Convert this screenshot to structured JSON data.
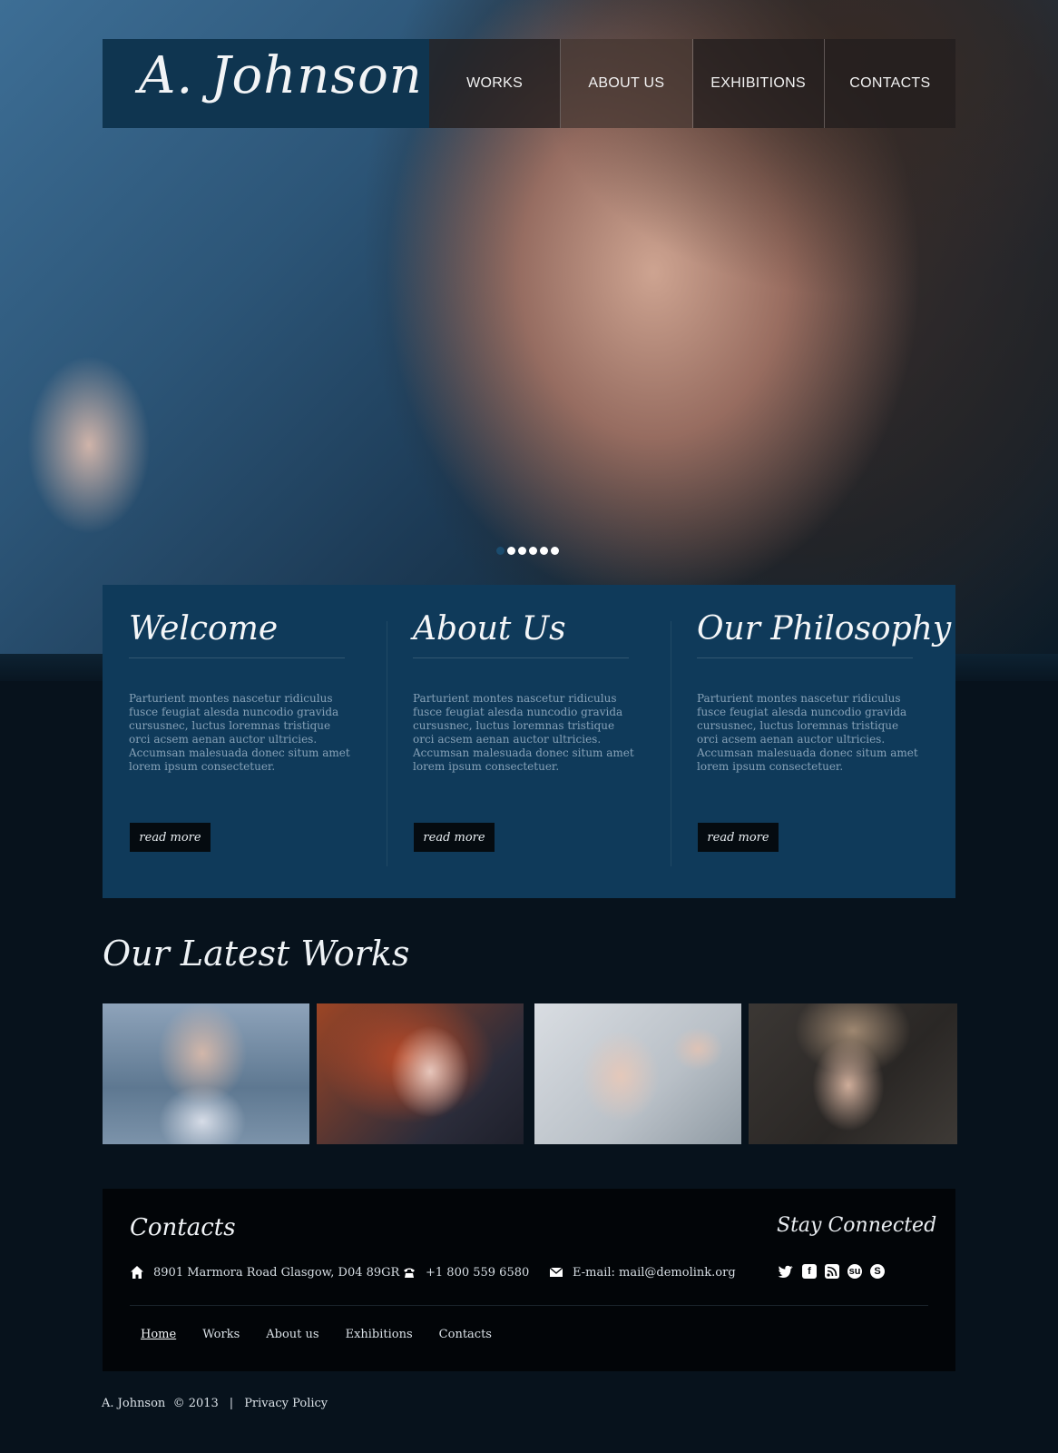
{
  "header": {
    "logo": "A. Johnson",
    "nav": [
      "WORKS",
      "ABOUT US",
      "EXHIBITIONS",
      "CONTACTS"
    ]
  },
  "slider": {
    "dot_count": 6,
    "active_index": 0
  },
  "features": [
    {
      "title": "Welcome",
      "text": "Parturient  montes nascetur ridiculus fusce feugiat alesda nuncodio gravida cursusnec, luctus loremnas tristique orci acsem aenan auctor ultricies. Accumsan malesuada donec situm amet lorem ipsum consectetuer.",
      "button": "read more"
    },
    {
      "title": "About Us",
      "text": "Parturient  montes nascetur ridiculus fusce feugiat alesda nuncodio gravida cursusnec, luctus loremnas tristique orci acsem aenan auctor ultricies. Accumsan malesuada donec situm amet lorem ipsum consectetuer.",
      "button": "read more"
    },
    {
      "title": "Our Philosophy",
      "text": "Parturient  montes nascetur ridiculus fusce feugiat alesda nuncodio gravida cursusnec, luctus loremnas tristique orci acsem aenan auctor ultricies. Accumsan malesuada donec situm amet lorem ipsum consectetuer.",
      "button": "read more"
    }
  ],
  "works": {
    "title": "Our Latest Works"
  },
  "footer": {
    "contacts_title": "Contacts",
    "address": "8901 Marmora Road Glasgow, D04 89GR",
    "phone": "+1 800 559 6580",
    "email": "E-mail: mail@demolink.org",
    "stay_title": "Stay Connected",
    "social_icons": [
      "twitter-icon",
      "facebook-icon",
      "rss-icon",
      "stumbleupon-icon",
      "skype-icon"
    ],
    "nav": [
      "Home",
      "Works",
      "About us",
      "Exhibitions",
      "Contacts"
    ],
    "copyright": "A. Johnson  © 2013",
    "privacy": "Privacy Policy",
    "separator": "|"
  },
  "colors": {
    "panel": "#0f3a5a",
    "logo_bg": "#0f3550",
    "footer_bg": "#020508",
    "page_bg": "#07121c"
  }
}
